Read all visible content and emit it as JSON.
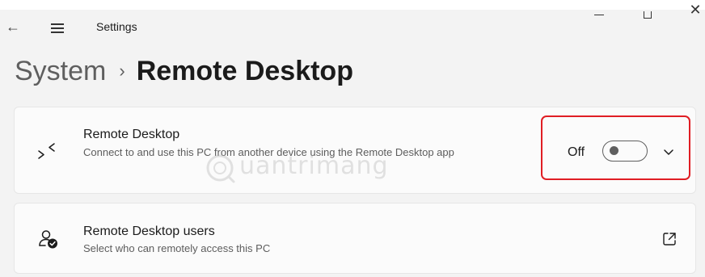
{
  "window": {
    "title": "Settings",
    "controls": [
      "minimize",
      "maximize",
      "close"
    ],
    "close_glyph": "✕",
    "back_glyph": "←"
  },
  "breadcrumb": {
    "parent": "System",
    "separator": "›",
    "current": "Remote Desktop"
  },
  "remote_desktop_card": {
    "icon": "remote-desktop-icon",
    "title": "Remote Desktop",
    "description": "Connect to and use this PC from another device using the Remote Desktop app",
    "toggle": {
      "state_label": "Off",
      "on": false
    },
    "expand_icon": "chevron-down-icon",
    "highlight_color": "#e01e24"
  },
  "users_card": {
    "icon": "user-check-icon",
    "title": "Remote Desktop users",
    "description": "Select who can remotely access this PC",
    "action_icon": "open-external-icon"
  },
  "watermark": {
    "text": "uantrimang",
    "logo": "quantrimang-logo"
  }
}
